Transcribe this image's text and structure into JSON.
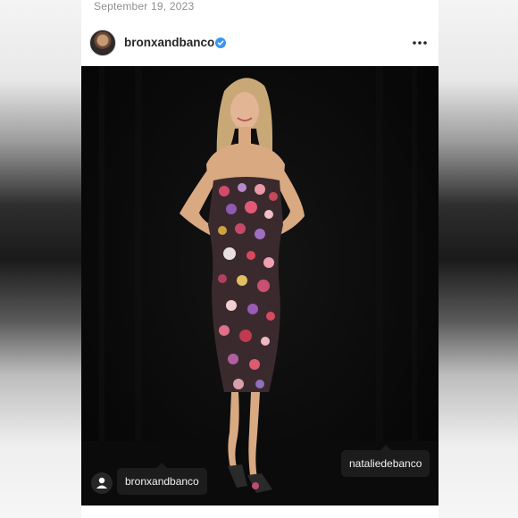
{
  "post": {
    "date": "September 19, 2023",
    "username": "bronxandbanco",
    "verified": true
  },
  "icons": {
    "verified": "verified-badge-icon",
    "more": "more-options-icon",
    "tagged_users": "user-tag-icon"
  },
  "tags": [
    {
      "label": "nataliedebanco"
    },
    {
      "label": "bronxandbanco"
    }
  ],
  "colors": {
    "verified_blue": "#3897f0",
    "text_primary": "#262626",
    "text_secondary": "#8e8e8e"
  }
}
